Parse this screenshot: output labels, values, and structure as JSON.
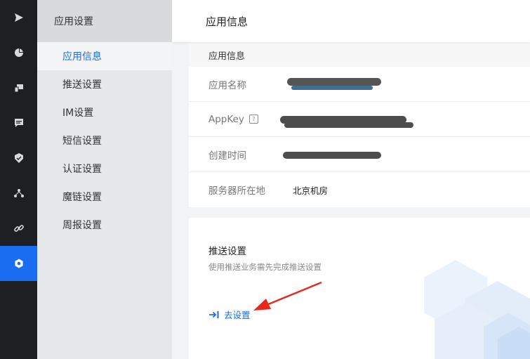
{
  "rail": {
    "icons": [
      "send-icon",
      "pie-chart-icon",
      "devices-icon",
      "message-icon",
      "shield-icon",
      "network-icon",
      "link-icon",
      "settings-hex-icon"
    ],
    "active_index": 7,
    "active_color": "#1a6df0"
  },
  "menu": {
    "header": "应用设置",
    "items": [
      {
        "label": "应用信息",
        "active": true
      },
      {
        "label": "推送设置",
        "active": false
      },
      {
        "label": "IM设置",
        "active": false
      },
      {
        "label": "短信设置",
        "active": false
      },
      {
        "label": "认证设置",
        "active": false
      },
      {
        "label": "魔链设置",
        "active": false
      },
      {
        "label": "周报设置",
        "active": false
      }
    ]
  },
  "topbar": {
    "title": "应用信息"
  },
  "app_info": {
    "section_title": "应用信息",
    "rows": [
      {
        "label": "应用名称",
        "value": "",
        "redacted": true
      },
      {
        "label": "AppKey",
        "value": "",
        "redacted": true,
        "help_icon": "question-icon"
      },
      {
        "label": "创建时间",
        "value": "",
        "redacted": true
      },
      {
        "label": "服务器所在地",
        "value": "北京机房",
        "redacted": false
      }
    ]
  },
  "push": {
    "title": "推送设置",
    "description": "使用推送业务需先完成推送设置",
    "action_label": "去设置",
    "action_icon": "arrow-to-line-icon"
  },
  "annotation": {
    "arrow_color": "#e8281c"
  }
}
